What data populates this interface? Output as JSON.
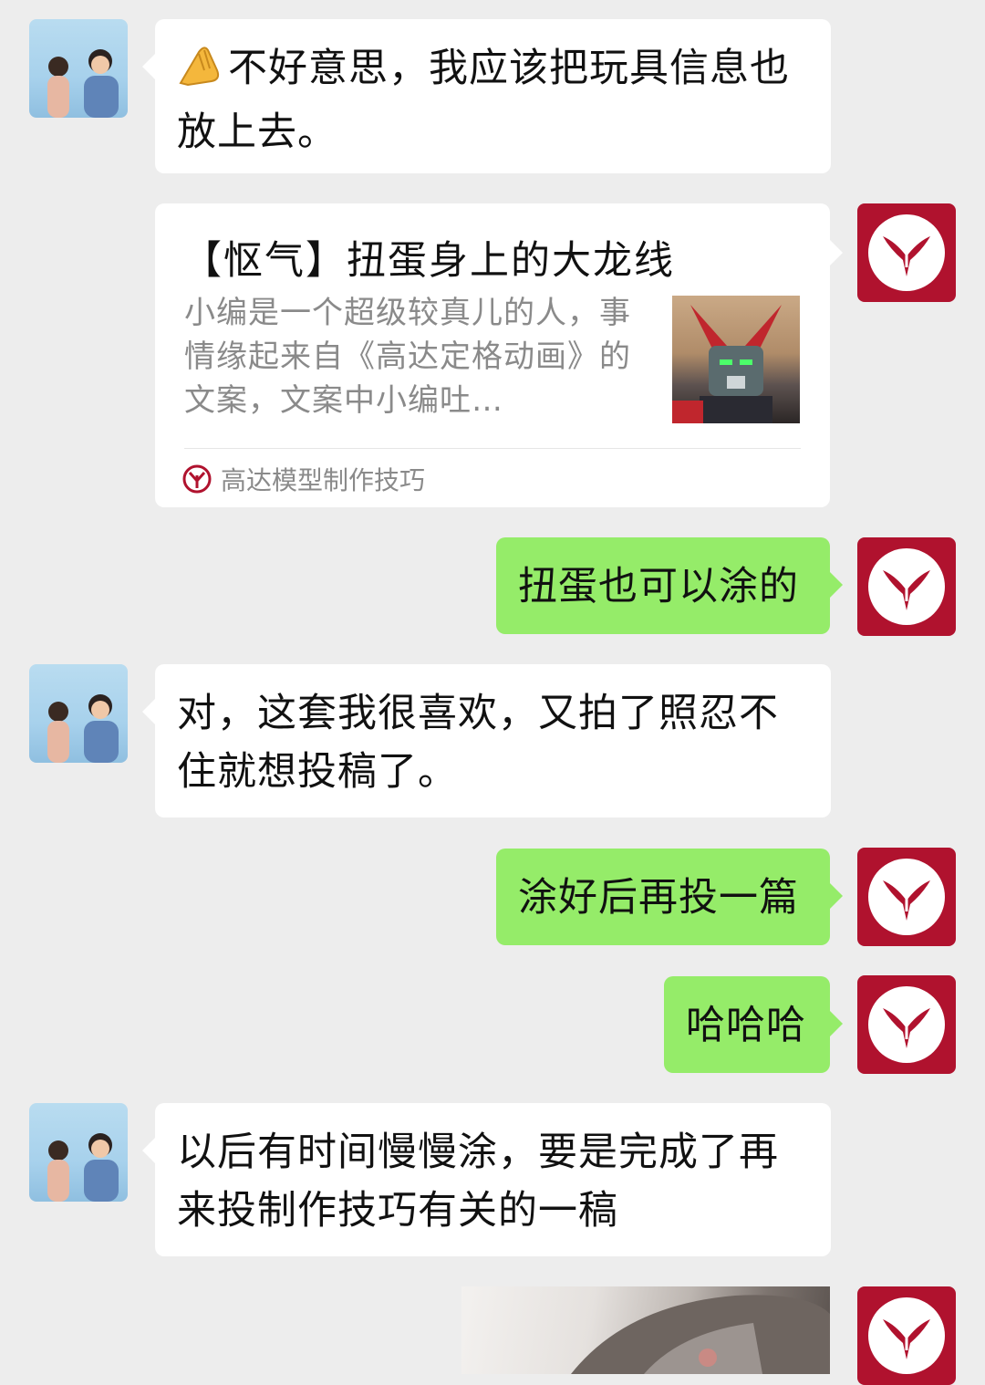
{
  "colors": {
    "background": "#ededed",
    "bubble_received": "#ffffff",
    "bubble_sent": "#95ec69",
    "brand": "#b0122e"
  },
  "messages": [
    {
      "side": "left",
      "type": "text",
      "icon": "pinched-fingers-emoji",
      "text": "不好意思，我应该把玩具信息也放上去。"
    },
    {
      "side": "right",
      "type": "link-card",
      "card": {
        "title": "【怄气】扭蛋身上的大龙线",
        "description": "小编是一个超级较真儿的人，事情缘起来自《高达定格动画》的文案，文案中小编吐…",
        "source": "高达模型制作技巧"
      }
    },
    {
      "side": "right",
      "type": "text",
      "text": "扭蛋也可以涂的"
    },
    {
      "side": "left",
      "type": "text",
      "text": "对，这套我很喜欢，又拍了照忍不住就想投稿了。"
    },
    {
      "side": "right",
      "type": "text",
      "text": "涂好后再投一篇"
    },
    {
      "side": "right",
      "type": "text",
      "text": "哈哈哈"
    },
    {
      "side": "left",
      "type": "text",
      "text": "以后有时间慢慢涂，要是完成了再来投制作技巧有关的一稿"
    },
    {
      "side": "right",
      "type": "image"
    }
  ]
}
